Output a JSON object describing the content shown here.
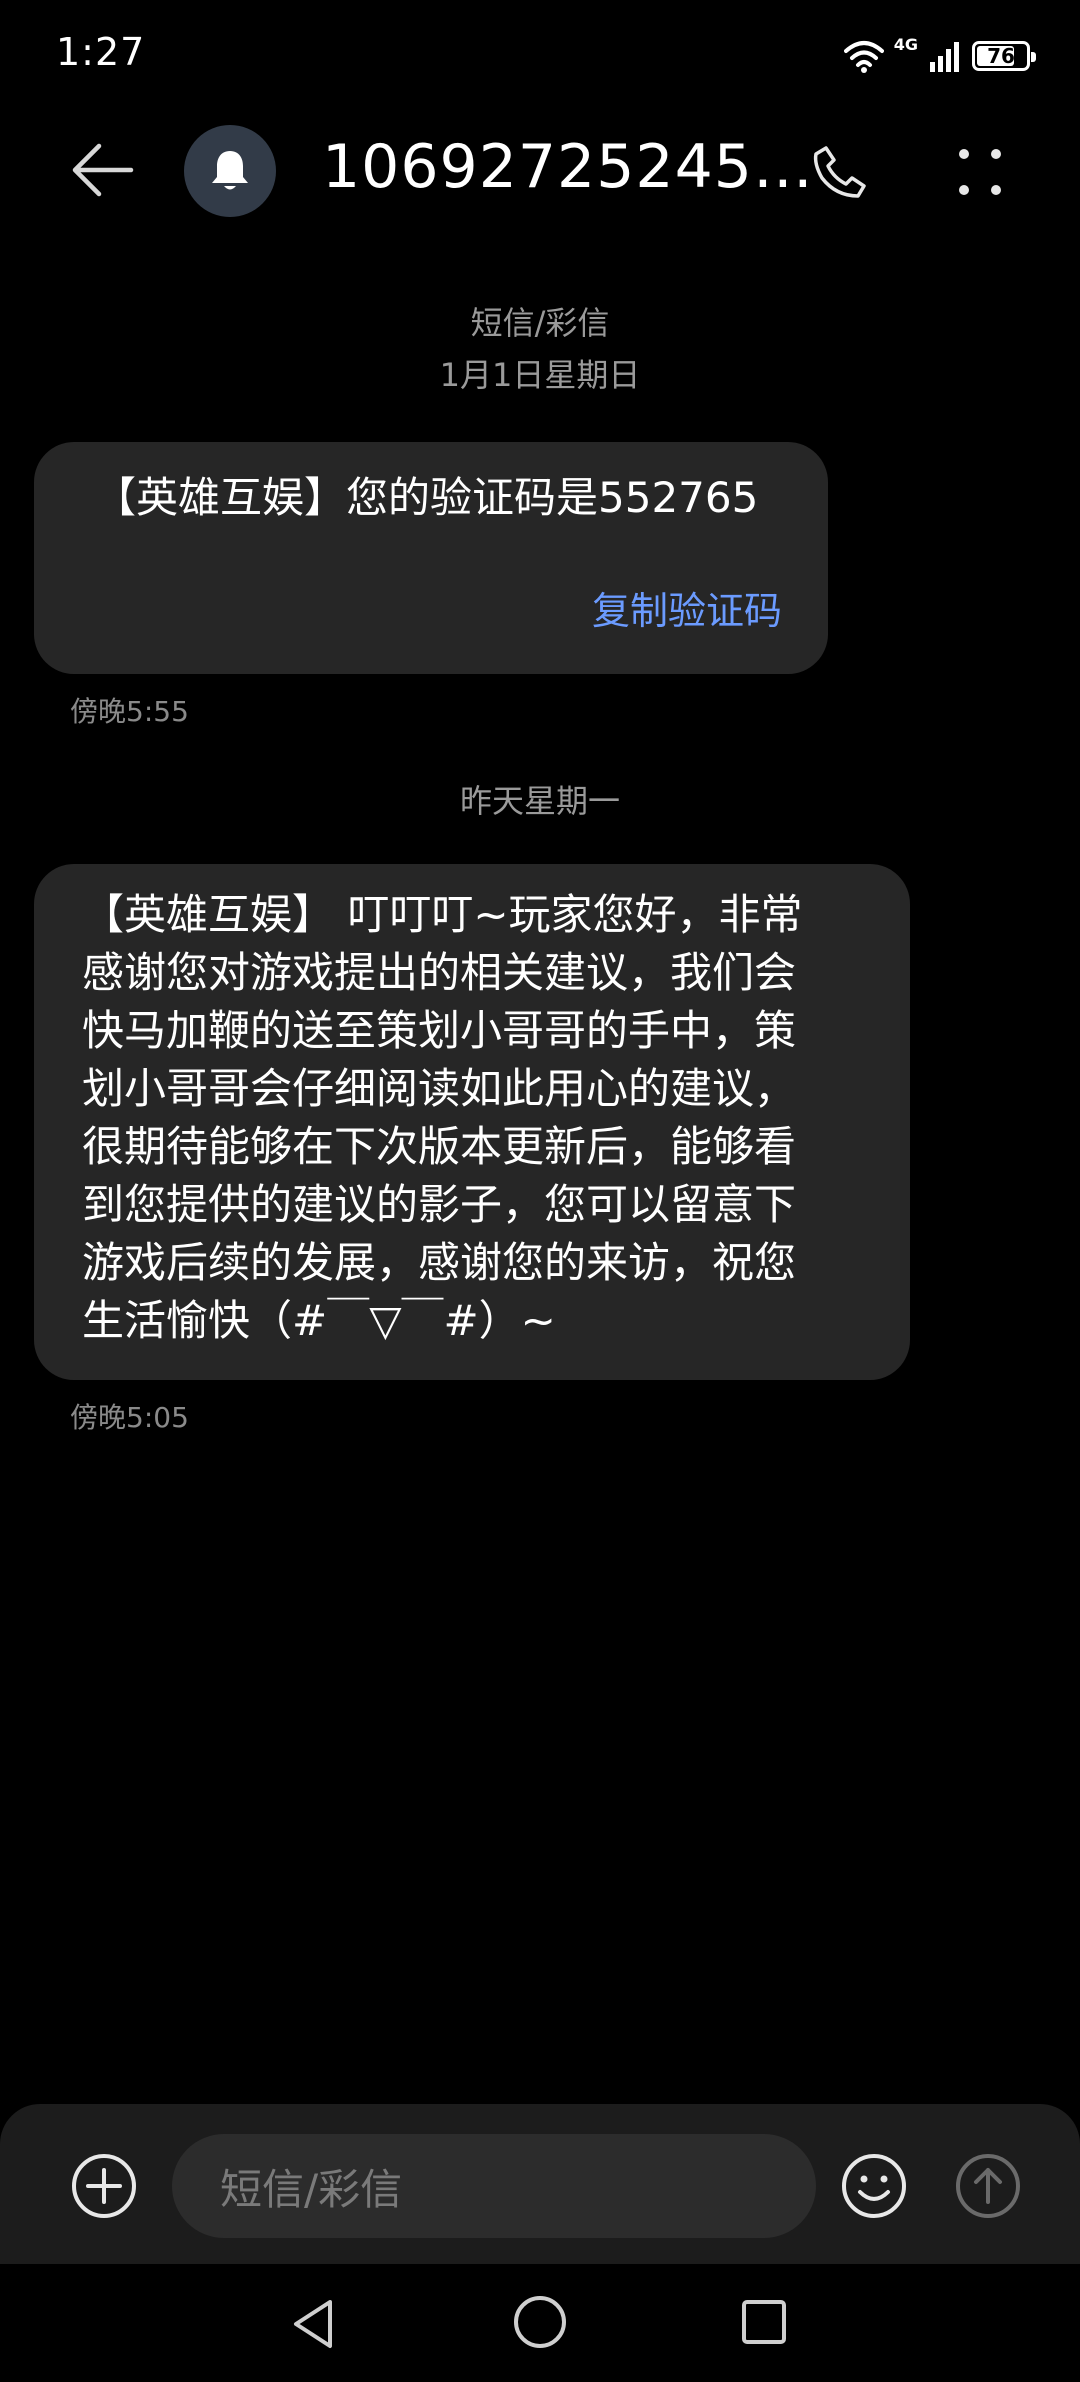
{
  "status_bar": {
    "time": "1:27",
    "network": "4G",
    "battery": "76"
  },
  "header": {
    "title": "10692725245…"
  },
  "thread": {
    "channel_label": "短信/彩信",
    "date_1": "1月1日星期日",
    "date_2": "昨天星期一"
  },
  "messages": [
    {
      "text": "【英雄互娱】您的验证码是552765",
      "action": "复制验证码",
      "time": "傍晚5:55"
    },
    {
      "lines": [
        "【英雄互娱】 叮叮叮~玩家您好，非常",
        "感谢您对游戏提出的相关建议，我们会",
        "快马加鞭的送至策划小哥哥的手中，策",
        "划小哥哥会仔细阅读如此用心的建议，",
        "很期待能够在下次版本更新后，能够看",
        "到您提供的建议的影子，您可以留意下",
        "游戏后续的发展，感谢您的来访，祝您",
        "生活愉快（#￣▽￣#）~"
      ],
      "time": "傍晚5:05"
    }
  ],
  "composer": {
    "placeholder": "短信/彩信"
  },
  "colors": {
    "background": "#000000",
    "bubble": "#262626",
    "link": "#6b9bff",
    "secondary_text": "#9a9a9a"
  }
}
